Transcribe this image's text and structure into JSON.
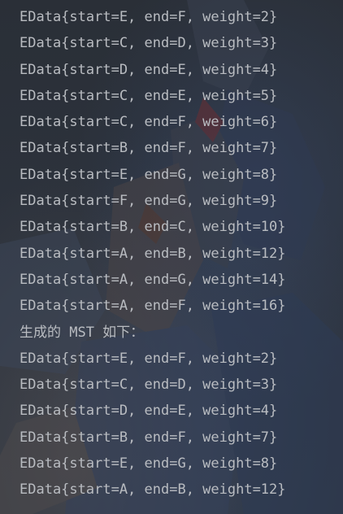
{
  "console": {
    "lines": [
      "EData{start=E, end=F, weight=2}",
      "EData{start=C, end=D, weight=3}",
      "EData{start=D, end=E, weight=4}",
      "EData{start=C, end=E, weight=5}",
      "EData{start=C, end=F, weight=6}",
      "EData{start=B, end=F, weight=7}",
      "EData{start=E, end=G, weight=8}",
      "EData{start=F, end=G, weight=9}",
      "EData{start=B, end=C, weight=10}",
      "EData{start=A, end=B, weight=12}",
      "EData{start=A, end=G, weight=14}",
      "EData{start=A, end=F, weight=16}",
      "生成的 MST 如下：",
      "EData{start=E, end=F, weight=2}",
      "EData{start=C, end=D, weight=3}",
      "EData{start=D, end=E, weight=4}",
      "EData{start=B, end=F, weight=7}",
      "EData{start=E, end=G, weight=8}",
      "EData{start=A, end=B, weight=12}"
    ]
  },
  "colors": {
    "text": "#b9bcc1",
    "background": "#2b2f36"
  }
}
